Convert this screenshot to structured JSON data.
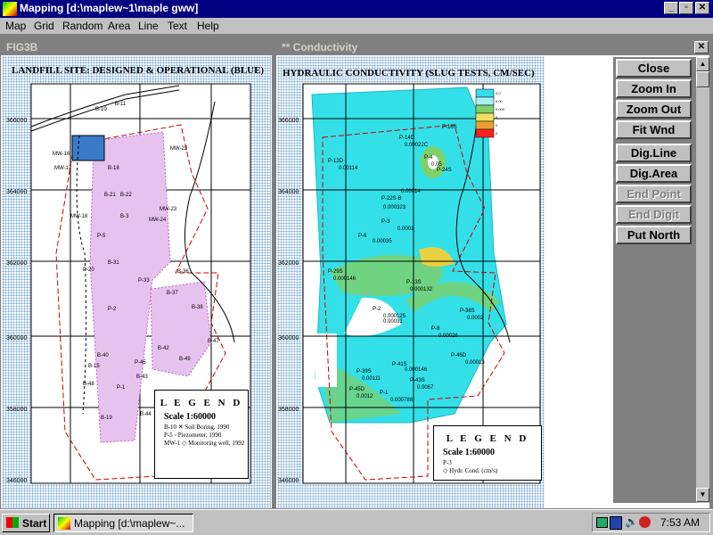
{
  "window": {
    "title": "Mapping [d:\\maplew~1\\maple gww]",
    "min_glyph": "_",
    "max_glyph": "▫",
    "close_glyph": "✕"
  },
  "menu": [
    "Map",
    "Grid",
    "Random",
    "Area",
    "Line",
    "Text",
    "Help"
  ],
  "left_doc": {
    "title": "FIG3B",
    "map_title": "LANDFILL SITE: DESIGNED & OPERATIONAL (BLUE)",
    "y_ticks": [
      "366000",
      "364000",
      "362000",
      "360000",
      "358000",
      "346000"
    ],
    "legend": {
      "title": "L E G E N D",
      "scale": "Scale 1:60000",
      "items": [
        "B-10  ✕ Soil Boring, 1990",
        "P-5  ◦ Piezometer, 1990",
        "MW-1  ◇ Monitoring well, 1992"
      ]
    },
    "points": [
      "B-10",
      "B-11",
      "MW-16",
      "MW-17",
      "B-18",
      "B-21",
      "B-22",
      "MW-22",
      "MW-23",
      "B-3",
      "P-5",
      "MW-24",
      "MW-18",
      "P-20",
      "B-31",
      "B-36",
      "P-33",
      "B-37",
      "P-2",
      "B-38",
      "B-42",
      "B-47",
      "B-49",
      "B-40",
      "P-45",
      "P-1",
      "B-48",
      "B-15",
      "B-43",
      "B-19",
      "B-44"
    ]
  },
  "right_doc": {
    "title": "** Conductivity",
    "close_glyph": "✕",
    "map_title": "HYDRAULIC CONDUCTIVITY (SLUG TESTS, CM/SEC)",
    "y_ticks": [
      "366000",
      "364000",
      "362000",
      "360000",
      "358000",
      "346000"
    ],
    "scale_labels": [
      "0.0",
      "0.00",
      "0.000",
      "0",
      "0",
      "0"
    ],
    "legend": {
      "title": "L E G E N D",
      "scale": "Scale 1:60000",
      "items": [
        "P-3",
        "◇ Hydr. Cond. (cm/s)"
      ]
    },
    "points": [
      "P-14D",
      "0.00022C",
      "P-16S",
      "P-12D",
      "0.00114",
      "P-4",
      "0.05",
      "P-24S",
      "0.00014",
      "P-22S B",
      "0.000323",
      "P-3",
      "0.0001",
      "P-6",
      "0.00035",
      "P-29S",
      "0.000146",
      "P-13S",
      "0.000132",
      "P-2",
      "0.000125",
      "0.00031",
      "P-38S",
      "0.0002",
      "P-8",
      "0.00026",
      "P-46D",
      "0.00013",
      "P-41S",
      "0.000146",
      "P-39S",
      "0.00111",
      "P-43S",
      "0.0067",
      "P-45D",
      "0.0012",
      "P-1",
      "0.000788"
    ]
  },
  "buttons": [
    {
      "label": "Close",
      "enabled": true
    },
    {
      "label": "Zoom In",
      "enabled": true
    },
    {
      "label": "Zoom Out",
      "enabled": true
    },
    {
      "label": "Fit Wnd",
      "enabled": true
    },
    {
      "label": "Dig.Line",
      "enabled": true
    },
    {
      "label": "Dig.Area",
      "enabled": true
    },
    {
      "label": "End Point",
      "enabled": false
    },
    {
      "label": "End Digit",
      "enabled": false
    },
    {
      "label": "Put North",
      "enabled": true
    }
  ],
  "taskbar": {
    "start": "Start",
    "item": "Mapping [d:\\maplew~...",
    "clock": "7:53 AM"
  },
  "colors": {
    "title_active": "#000080",
    "title_inactive": "#808080",
    "conductivity_cyan": "#33e0e8",
    "conductivity_green": "#7fd068",
    "site_boundary": "#cc0000",
    "designed_fill": "#d9a8e6",
    "operational_blue": "#3a7ac8"
  }
}
